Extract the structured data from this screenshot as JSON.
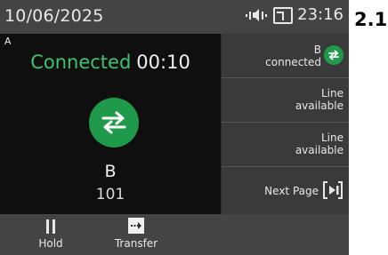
{
  "status_bar": {
    "date": "10/06/2025",
    "time": "23:16"
  },
  "call": {
    "line": "A",
    "state": "Connected",
    "duration": "00:10",
    "party_name": "B",
    "party_number": "101"
  },
  "lines": [
    {
      "name": "B",
      "status": "connected"
    },
    {
      "status_line1": "Line",
      "status_line2": "available"
    },
    {
      "status_line1": "Line",
      "status_line2": "available"
    },
    {
      "label": "Next Page"
    }
  ],
  "softkeys": [
    {
      "label": "Hold"
    },
    {
      "label": "Transfer"
    }
  ],
  "badge": "2.1",
  "colors": {
    "accent_green": "#1f9a4a",
    "connected_text": "#3ec46d",
    "panel_bg": "#0f0f0f"
  }
}
